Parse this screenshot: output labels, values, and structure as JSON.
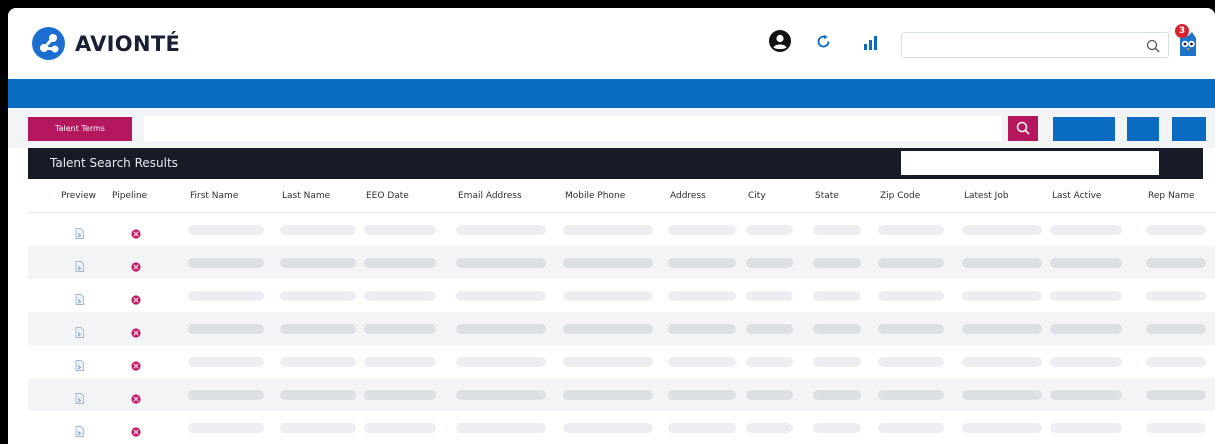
{
  "app": {
    "name": "AVIONTÉ"
  },
  "header": {
    "search_placeholder": "",
    "notification_count": "3"
  },
  "toolbar": {
    "terms_label": "Talent Terms",
    "terms_placeholder": ""
  },
  "results": {
    "title": "Talent Search Results",
    "filter_placeholder": ""
  },
  "table": {
    "columns": [
      "Preview",
      "Pipeline",
      "First Name",
      "Last Name",
      "EEO Date",
      "Email Address",
      "Mobile Phone",
      "Address",
      "City",
      "State",
      "Zip Code",
      "Latest Job",
      "Last Active",
      "Rep Name"
    ],
    "row_count": 7
  },
  "colors": {
    "brand_blue": "#0a6cc0",
    "accent_magenta": "#b5175e",
    "header_dark": "#171b27",
    "placeholder_bar": "#eceef1"
  },
  "icons": {
    "logo": "avionte-logo-icon",
    "user": "user-circle-icon",
    "refresh": "refresh-icon",
    "stats": "bar-chart-icon",
    "search": "search-icon",
    "notifications": "owl-notification-icon",
    "preview": "document-preview-icon",
    "pipeline": "pipeline-status-icon"
  }
}
